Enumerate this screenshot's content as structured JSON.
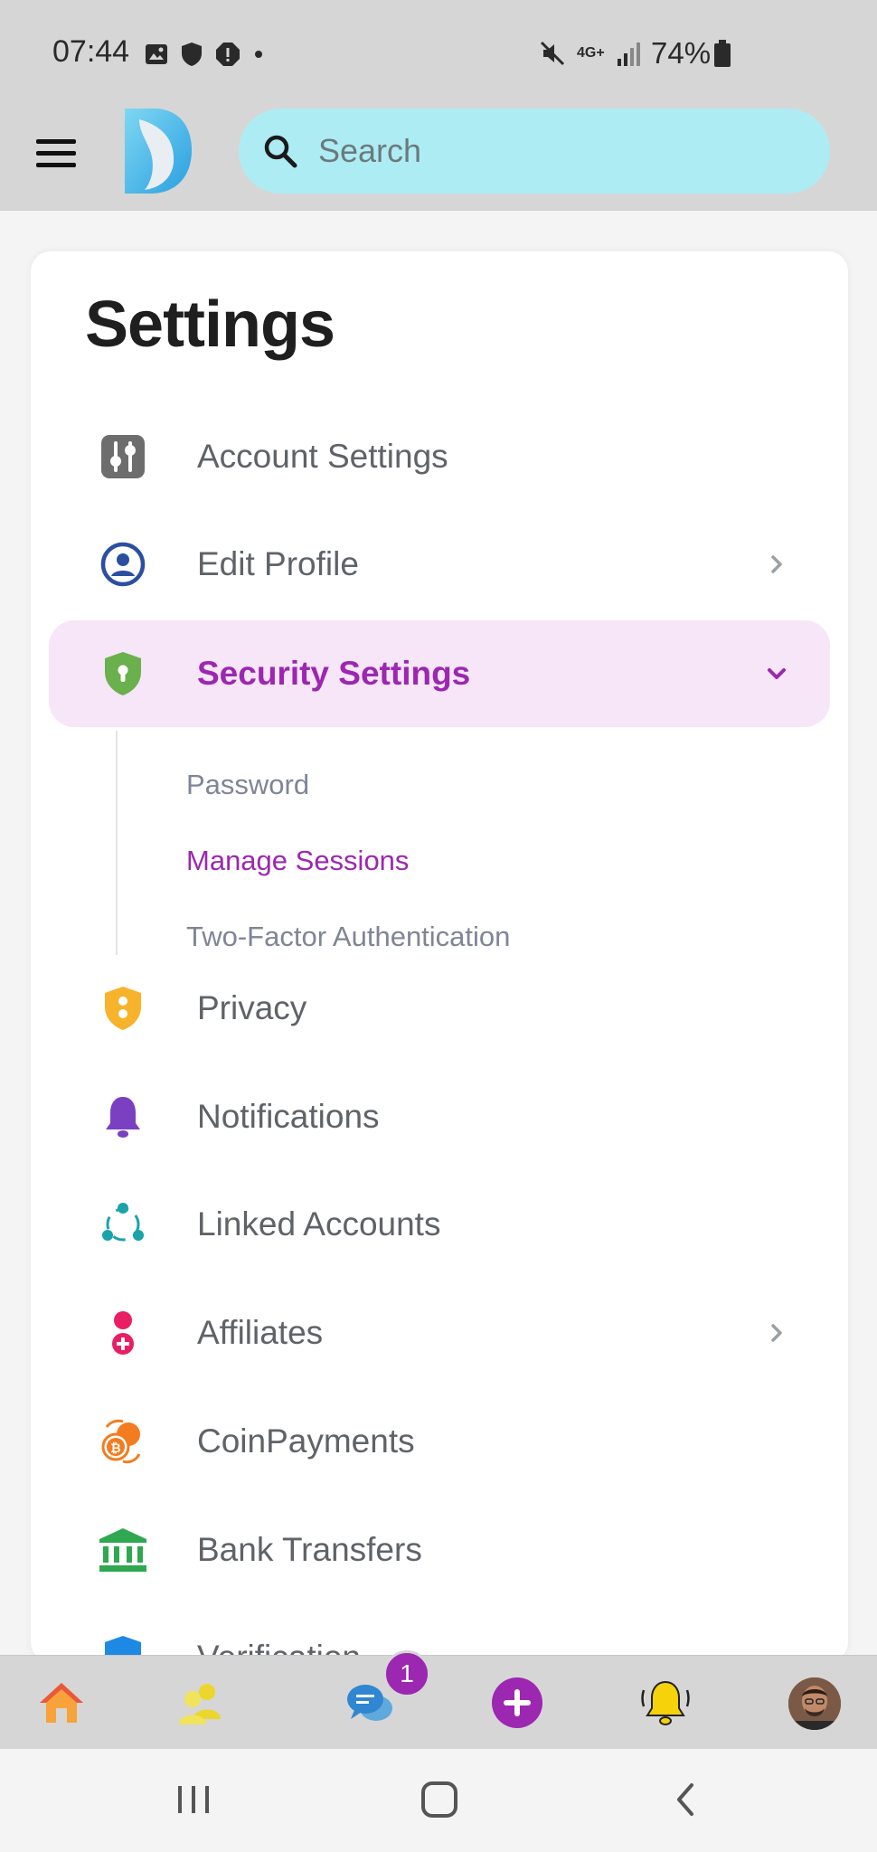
{
  "status_bar": {
    "time": "07:44",
    "network": "4G+",
    "battery": "74%"
  },
  "header": {
    "search_placeholder": "Search"
  },
  "settings": {
    "title": "Settings",
    "items": [
      {
        "label": "Account Settings",
        "icon": "sliders-icon"
      },
      {
        "label": "Edit Profile",
        "icon": "user-circle-icon",
        "has_chevron": true
      },
      {
        "label": "Security Settings",
        "icon": "shield-lock-icon",
        "active": true,
        "expanded": true
      },
      {
        "label": "Privacy",
        "icon": "privacy-shield-icon"
      },
      {
        "label": "Notifications",
        "icon": "bell-icon"
      },
      {
        "label": "Linked Accounts",
        "icon": "linked-nodes-icon"
      },
      {
        "label": "Affiliates",
        "icon": "affiliate-user-icon",
        "has_chevron": true
      },
      {
        "label": "CoinPayments",
        "icon": "coin-exchange-icon"
      },
      {
        "label": "Bank Transfers",
        "icon": "bank-icon"
      },
      {
        "label": "Verification",
        "icon": "verification-icon"
      }
    ],
    "security_subitems": [
      {
        "label": "Password"
      },
      {
        "label": "Manage Sessions",
        "active": true
      },
      {
        "label": "Two-Factor Authentication"
      }
    ]
  },
  "bottom_nav": {
    "messages_badge": "1"
  },
  "colors": {
    "accent": "#9c27b0",
    "search_bg": "#aeecf4",
    "active_bg": "#f6e6f8"
  }
}
